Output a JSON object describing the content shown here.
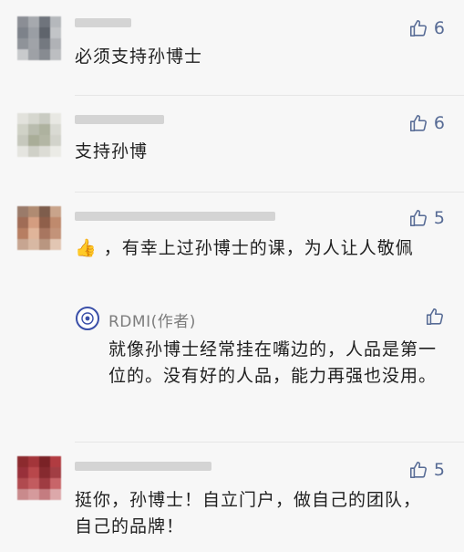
{
  "comments": [
    {
      "text": "必须支持孙博士",
      "likes": "6",
      "avatar_colors": [
        "#8b8e95",
        "#a6a9ae",
        "#6f747c",
        "#b5b8bc",
        "#7d828a",
        "#9a9ea4",
        "#5f646c",
        "#c2c4c7",
        "#8f9399",
        "#a0a3a8",
        "#747980",
        "#b0b2b6",
        "#c8cacc",
        "#9ea1a6",
        "#878b91",
        "#bcbec1"
      ]
    },
    {
      "text": "支持孙博",
      "likes": "6",
      "avatar_colors": [
        "#e2e2dc",
        "#d6d7cf",
        "#c9cbc2",
        "#e8e8e3",
        "#d0d2c7",
        "#b9bcae",
        "#aeb29f",
        "#d9dad3",
        "#c6c8bd",
        "#a9ad98",
        "#b3b6a4",
        "#d2d3cb",
        "#e5e5e0",
        "#cfd0c7",
        "#dcdcd5",
        "#ebebe6"
      ]
    },
    {
      "text": "👍 ，有幸上过孙博士的课，为人让人敬佩",
      "likes": "5",
      "avatar_colors": [
        "#9a7b6a",
        "#b08b72",
        "#7e5d4c",
        "#c9a48b",
        "#a06c56",
        "#d49d80",
        "#8f5f4a",
        "#bf8a6d",
        "#b77e62",
        "#e0b59a",
        "#a87660",
        "#c39379",
        "#c7a591",
        "#d8b8a3",
        "#b99680",
        "#e2c6b3"
      ],
      "reply": {
        "author": "RDMI(作者)",
        "text": "就像孙博士经常挂在嘴边的，人品是第一位的。没有好的人品，能力再强也没用。"
      }
    },
    {
      "text": "挺你，孙博士！自立门户，做自己的团队，自己的品牌！",
      "likes": "5",
      "avatar_colors": [
        "#8c2a2e",
        "#a3353a",
        "#7a2226",
        "#b13c41",
        "#98303a",
        "#b8474b",
        "#862a2f",
        "#a23e44",
        "#b04a4f",
        "#c25b5f",
        "#9f3c42",
        "#c86569",
        "#c98a8c",
        "#d59a9c",
        "#c47c80",
        "#dca8aa"
      ]
    }
  ],
  "colors": {
    "accent": "#576b95",
    "text": "#1f1f1f",
    "secondary": "#7d7d7d",
    "background": "#f7f7f7"
  },
  "icons": {
    "like": "thumb-up-icon",
    "author_logo": "rdmi-logo-icon"
  }
}
